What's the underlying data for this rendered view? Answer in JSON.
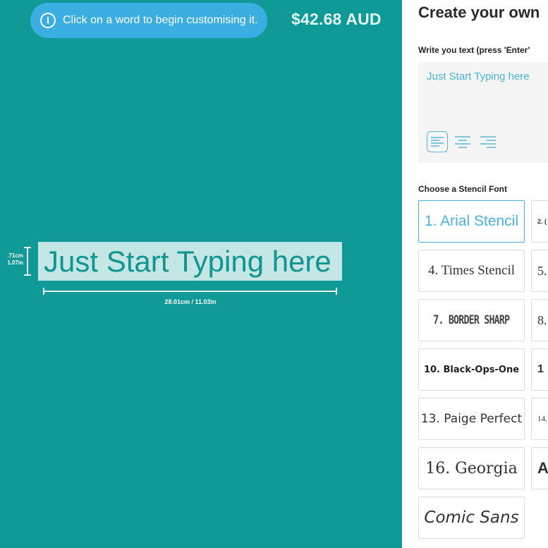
{
  "canvas": {
    "tip": "Click on a word to begin customising it.",
    "price": "$42.68 AUD",
    "preview_text": "Just Start Typing here",
    "height_label_line1": ".71cm",
    "height_label_line2": "1.07in",
    "width_label": "28.01cm / 11.03in",
    "colors": {
      "background": "#109a97",
      "tip": "#3aaee0",
      "preview_highlight": "#c4e6e4"
    }
  },
  "panel": {
    "title": "Create your own",
    "text_label": "Write you text (press 'Enter'",
    "text_value": "Just Start Typing here",
    "font_label": "Choose a Stencil Font",
    "fonts": [
      {
        "label": "1. Arial Stencil"
      },
      {
        "label": "2. ("
      },
      {
        "label": "4. Times Stencil"
      },
      {
        "label": "5."
      },
      {
        "label": "7. BORDER SHARP"
      },
      {
        "label": "8."
      },
      {
        "label": "10. Black-Ops-One"
      },
      {
        "label": "1"
      },
      {
        "label": "13. Paige Perfect"
      },
      {
        "label": "14."
      },
      {
        "label": "16. Georgia"
      },
      {
        "label": "A"
      },
      {
        "label": "Comic Sans"
      }
    ]
  }
}
